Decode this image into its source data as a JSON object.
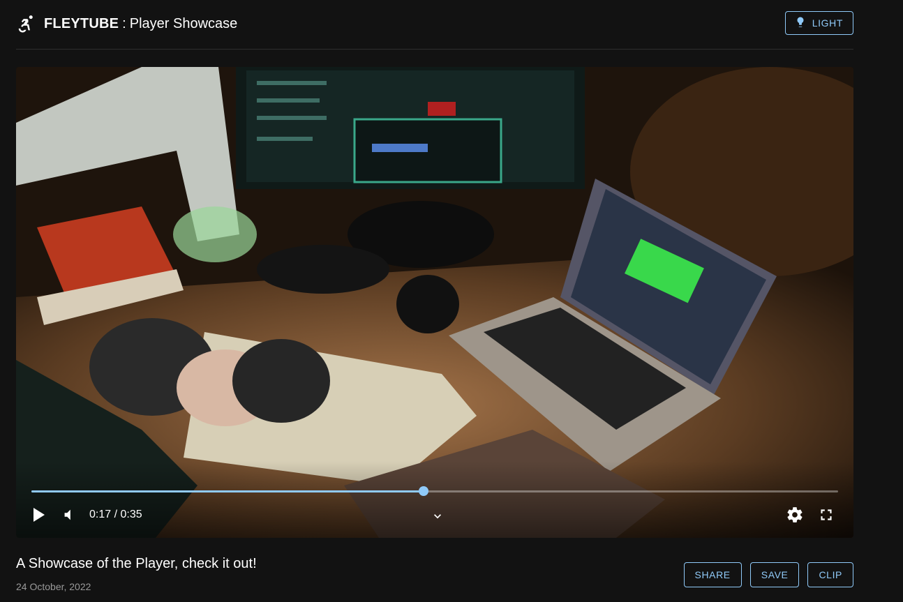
{
  "header": {
    "brand_name": "FLEYTUBE",
    "separator": ":",
    "page_title": "Player Showcase",
    "brand_icon": "accessible-forward-icon",
    "theme_button_label": "LIGHT",
    "theme_button_icon": "lightbulb-icon"
  },
  "player": {
    "current_time": "0:17",
    "duration": "0:35",
    "time_display": "0:17 / 0:35",
    "progress_fraction": 0.486,
    "icons": [
      "play-icon",
      "volume-icon",
      "chevron-down-icon",
      "settings-icon",
      "fullscreen-icon"
    ]
  },
  "video_info": {
    "title": "A Showcase of the Player, check it out!",
    "date": "24 October, 2022"
  },
  "actions": {
    "share": "SHARE",
    "save": "SAVE",
    "clip": "CLIP"
  },
  "colors": {
    "background": "#121212",
    "accent": "#90caf9",
    "text": "#ffffff",
    "muted": "#9a9a9a"
  }
}
